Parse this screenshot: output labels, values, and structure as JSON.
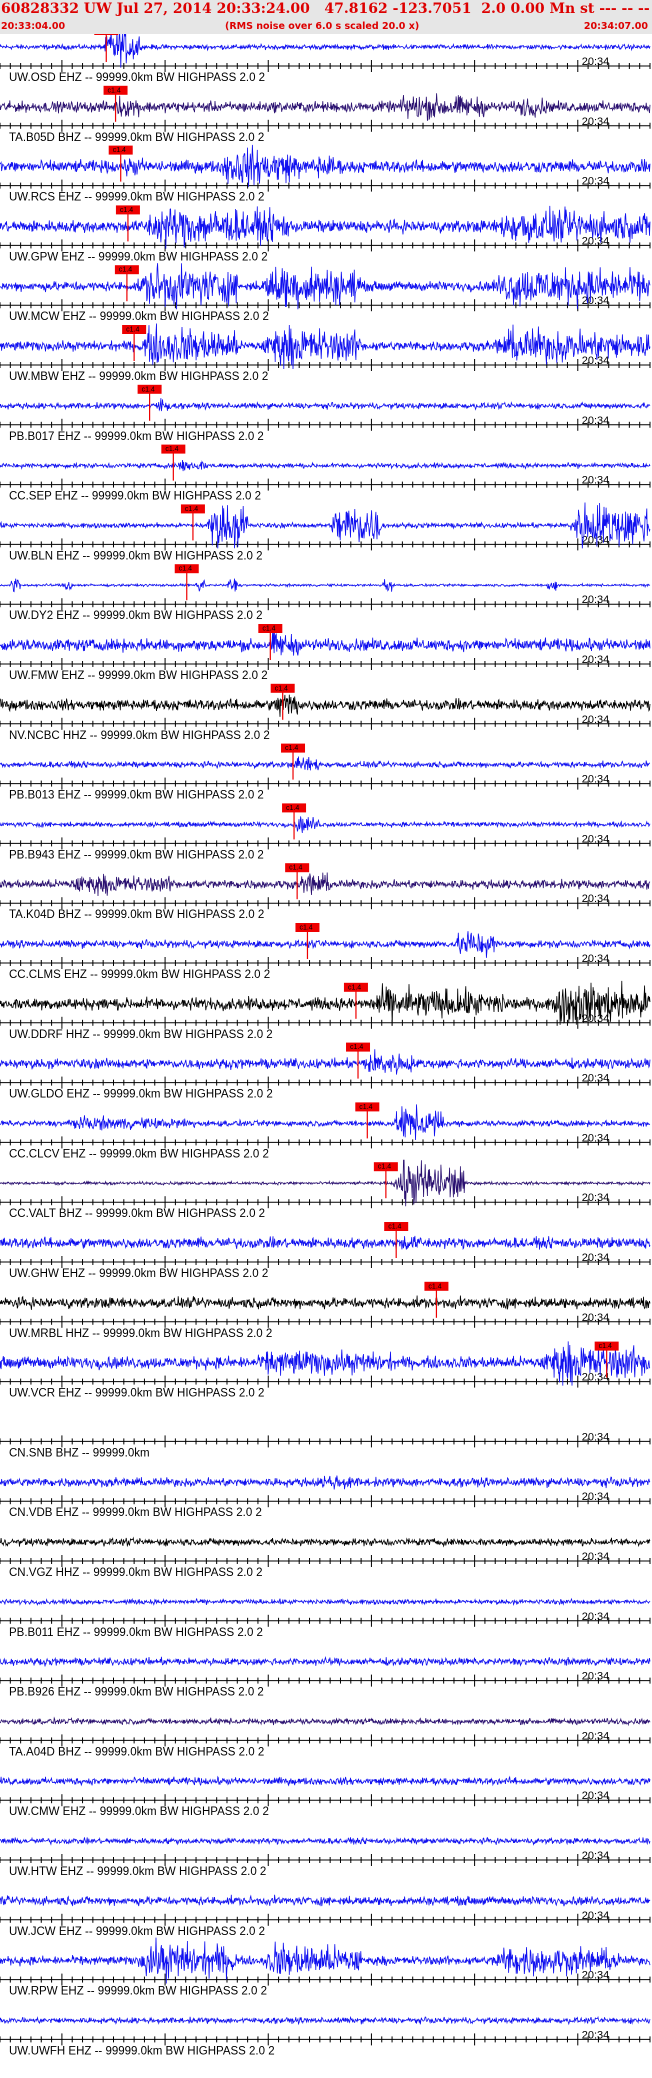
{
  "header": {
    "title": "60828332 UW Jul 27, 2014 20:33:24.00   47.8162 -123.7051  2.0 0.00 Mn st --- -- --   -1",
    "start_time": "20:33:04.00",
    "note": "(RMS noise over 6.0 s scaled 20.0 x)",
    "end_time": "20:34:07.00"
  },
  "chart_data": {
    "type": "line",
    "title": "60828332 UW Jul 27, 2014 20:33:24.00   47.8162 -123.7051  2.0 0.00 Mn st --- -- --   -1",
    "x_start": "20:33:04.00",
    "x_end": "20:34:07.00",
    "x_range_seconds": [
      0,
      63
    ],
    "minute_label": "20:34",
    "minute_mark_seconds": 56,
    "pick_label": "c1.4",
    "colors": {
      "blue": "#1010f0",
      "black": "#000000",
      "navy": "#2a1070",
      "red": "#ee0000"
    },
    "traces": [
      {
        "label": "UW.OSD EHZ -- 99999.0km BW  HIGHPASS  2.0  2",
        "pick": 10.3,
        "color": "blue",
        "amp": 0.1,
        "bursts": [
          [
            10.0,
            13.5,
            0.9
          ]
        ]
      },
      {
        "label": "TA.B05D BHZ -- 99999.0km BW  HIGHPASS  2.0  2",
        "pick": 11.2,
        "color": "navy",
        "amp": 0.22,
        "bursts": [
          [
            11,
            14,
            0.5
          ],
          [
            38,
            47,
            0.6
          ],
          [
            50,
            53,
            0.5
          ]
        ]
      },
      {
        "label": "UW.RCS EHZ -- 99999.0km BW  HIGHPASS  2.0  2",
        "pick": 11.7,
        "color": "blue",
        "amp": 0.25,
        "bursts": [
          [
            12,
            14,
            0.5
          ],
          [
            21,
            29,
            0.9
          ],
          [
            30,
            33,
            0.6
          ]
        ]
      },
      {
        "label": "UW.GPW EHZ -- 99999.0km BW  HIGHPASS  2.0  2",
        "pick": 12.4,
        "color": "blue",
        "amp": 0.25,
        "bursts": [
          [
            13,
            28,
            0.9
          ],
          [
            47,
            63,
            0.8
          ]
        ]
      },
      {
        "label": "UW.MCW EHZ -- 99999.0km BW  HIGHPASS  2.0  2",
        "pick": 12.3,
        "color": "blue",
        "amp": 0.2,
        "bursts": [
          [
            13,
            23,
            1.0
          ],
          [
            25,
            35,
            1.0
          ],
          [
            47,
            63,
            0.9
          ]
        ]
      },
      {
        "label": "UW.MBW EHZ -- 99999.0km BW  HIGHPASS  2.0  2",
        "pick": 13.0,
        "color": "blue",
        "amp": 0.2,
        "bursts": [
          [
            13,
            23,
            0.9
          ],
          [
            25,
            35,
            0.9
          ],
          [
            47,
            63,
            0.8
          ]
        ]
      },
      {
        "label": "PB.B017 EHZ -- 99999.0km BW  HIGHPASS  2.0  2",
        "pick": 14.5,
        "color": "blue",
        "amp": 0.12,
        "bursts": [
          [
            15,
            16.5,
            0.4
          ]
        ]
      },
      {
        "label": "CC.SEP EHZ -- 99999.0km BW  HIGHPASS  2.0  2",
        "pick": 16.8,
        "color": "blue",
        "amp": 0.1,
        "bursts": [
          [
            17,
            20,
            0.3
          ]
        ]
      },
      {
        "label": "UW.BLN EHZ -- 99999.0km BW  HIGHPASS  2.0  2",
        "pick": 18.7,
        "color": "blue",
        "amp": 0.1,
        "bursts": [
          [
            20,
            24,
            1.1
          ],
          [
            32,
            37,
            1.1
          ],
          [
            55,
            63,
            1.1
          ]
        ]
      },
      {
        "label": "UW.DY2 EHZ -- 99999.0km BW  HIGHPASS  2.0  2",
        "pick": 18.1,
        "color": "blue",
        "amp": 0.05,
        "bursts": [
          [
            1,
            2,
            0.4
          ],
          [
            6,
            7,
            0.4
          ],
          [
            19,
            20,
            0.4
          ],
          [
            22,
            23,
            0.4
          ],
          [
            37,
            38,
            0.4
          ],
          [
            53,
            54,
            0.4
          ]
        ]
      },
      {
        "label": "UW.FMW EHZ -- 99999.0km BW  HIGHPASS  2.0  2",
        "pick": 26.2,
        "color": "blue",
        "amp": 0.25,
        "bursts": [
          [
            26,
            29,
            0.6
          ]
        ]
      },
      {
        "label": "NV.NCBC HHZ -- 99999.0km BW  HIGHPASS  2.0  2",
        "pick": 27.4,
        "color": "black",
        "amp": 0.22,
        "bursts": [
          [
            26.5,
            29,
            0.7
          ]
        ]
      },
      {
        "label": "PB.B013 EHZ -- 99999.0km BW  HIGHPASS  2.0  2",
        "pick": 28.4,
        "color": "blue",
        "amp": 0.12,
        "bursts": [
          [
            28.5,
            31,
            0.4
          ]
        ]
      },
      {
        "label": "PB.B943 EHZ -- 99999.0km BW  HIGHPASS  2.0  2",
        "pick": 28.5,
        "color": "blue",
        "amp": 0.1,
        "bursts": [
          [
            28.5,
            31,
            0.4
          ]
        ]
      },
      {
        "label": "TA.K04D BHZ -- 99999.0km BW  HIGHPASS  2.0  2",
        "pick": 28.8,
        "color": "navy",
        "amp": 0.18,
        "bursts": [
          [
            6,
            17,
            0.45
          ],
          [
            29,
            32,
            0.6
          ]
        ]
      },
      {
        "label": "CC.CLMS EHZ -- 99999.0km BW  HIGHPASS  2.0  2",
        "pick": 29.8,
        "color": "blue",
        "amp": 0.15,
        "bursts": [
          [
            44,
            48,
            0.7
          ]
        ]
      },
      {
        "label": "UW.DDRF HHZ -- 99999.0km BW  HIGHPASS  2.0  2",
        "pick": 34.5,
        "color": "black",
        "amp": 0.25,
        "bursts": [
          [
            35,
            49,
            0.75
          ],
          [
            53,
            63,
            1.0
          ]
        ]
      },
      {
        "label": "UW.GLDO EHZ -- 99999.0km BW  HIGHPASS  2.0  2",
        "pick": 34.7,
        "color": "blue",
        "amp": 0.2,
        "bursts": [
          [
            35,
            40,
            0.6
          ]
        ]
      },
      {
        "label": "CC.CLCV EHZ -- 99999.0km BW  HIGHPASS  2.0  2",
        "pick": 35.6,
        "color": "blue",
        "amp": 0.12,
        "bursts": [
          [
            5,
            19,
            0.3
          ],
          [
            38,
            43,
            0.8
          ]
        ]
      },
      {
        "label": "CC.VALT BHZ -- 99999.0km BW  HIGHPASS  2.0  2",
        "pick": 37.4,
        "color": "navy",
        "amp": 0.06,
        "bursts": [
          [
            38,
            45,
            1.1
          ]
        ]
      },
      {
        "label": "UW.GHW EHZ -- 99999.0km BW  HIGHPASS  2.0  2",
        "pick": 38.4,
        "color": "blue",
        "amp": 0.22,
        "bursts": [
          [
            38.5,
            41,
            0.4
          ]
        ]
      },
      {
        "label": "UW.MRBL HHZ -- 99999.0km BW  HIGHPASS  2.0  2",
        "pick": 42.3,
        "color": "black",
        "amp": 0.22,
        "bursts": []
      },
      {
        "label": "UW.VCR EHZ -- 99999.0km BW  HIGHPASS  2.0  2",
        "pick": 58.8,
        "color": "blue",
        "amp": 0.25,
        "bursts": [
          [
            24,
            38,
            0.6
          ],
          [
            52,
            63,
            0.9
          ]
        ]
      },
      {
        "label": "CN.SNB BHZ -- 99999.0km",
        "pick": null,
        "color": "blue",
        "amp": 0,
        "bursts": []
      },
      {
        "label": "CN.VDB EHZ -- 99999.0km BW  HIGHPASS  2.0  2",
        "pick": null,
        "color": "blue",
        "amp": 0.18,
        "bursts": [
          [
            31,
            34,
            0.4
          ]
        ]
      },
      {
        "label": "CN.VGZ HHZ -- 99999.0km BW  HIGHPASS  2.0  2",
        "pick": null,
        "color": "black",
        "amp": 0.15,
        "bursts": []
      },
      {
        "label": "PB.B011 EHZ -- 99999.0km BW  HIGHPASS  2.0  2",
        "pick": null,
        "color": "blue",
        "amp": 0.1,
        "bursts": []
      },
      {
        "label": "PB.B926 EHZ -- 99999.0km BW  HIGHPASS  2.0  2",
        "pick": null,
        "color": "blue",
        "amp": 0.15,
        "bursts": []
      },
      {
        "label": "TA.A04D BHZ -- 99999.0km BW  HIGHPASS  2.0  2",
        "pick": null,
        "color": "navy",
        "amp": 0.12,
        "bursts": []
      },
      {
        "label": "UW.CMW EHZ -- 99999.0km BW  HIGHPASS  2.0  2",
        "pick": null,
        "color": "blue",
        "amp": 0.15,
        "bursts": []
      },
      {
        "label": "UW.HTW EHZ -- 99999.0km BW  HIGHPASS  2.0  2",
        "pick": null,
        "color": "blue",
        "amp": 0.12,
        "bursts": []
      },
      {
        "label": "UW.JCW EHZ -- 99999.0km BW  HIGHPASS  2.0  2",
        "pick": null,
        "color": "blue",
        "amp": 0.18,
        "bursts": []
      },
      {
        "label": "UW.RPW EHZ -- 99999.0km BW  HIGHPASS  2.0  2",
        "pick": null,
        "color": "blue",
        "amp": 0.18,
        "bursts": [
          [
            13,
            23,
            0.9
          ],
          [
            25,
            35,
            0.8
          ],
          [
            47,
            60,
            0.7
          ]
        ]
      },
      {
        "label": "UW.UWFH EHZ -- 99999.0km BW  HIGHPASS  2.0  2",
        "pick": null,
        "color": "blue",
        "amp": 0.12,
        "bursts": []
      }
    ]
  }
}
